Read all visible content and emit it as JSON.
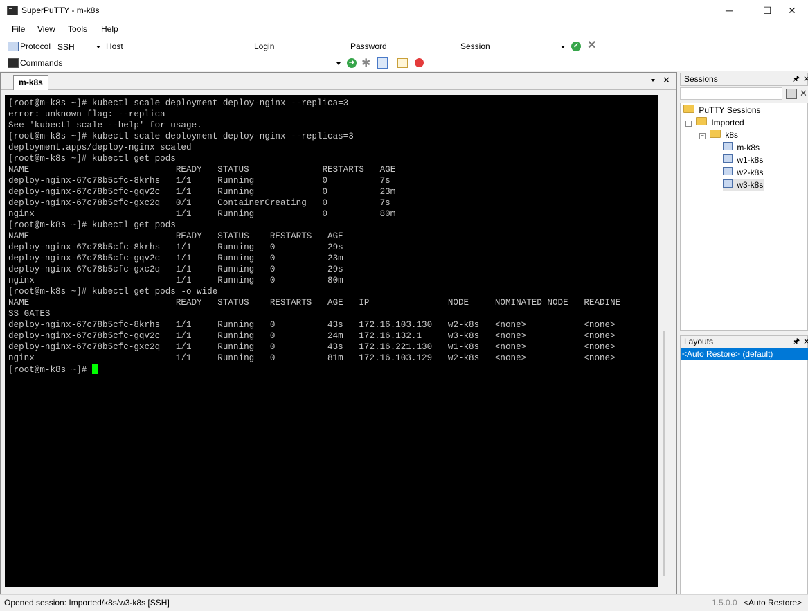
{
  "window": {
    "title": "SuperPuTTY - m-k8s",
    "controls": {
      "minimize": "─",
      "maximize": "☐",
      "close": "✕"
    }
  },
  "menu": [
    "File",
    "View",
    "Tools",
    "Help"
  ],
  "connection_bar": {
    "protocol_label": "Protocol",
    "protocol_value": "SSH",
    "host_label": "Host",
    "host_value": "",
    "login_label": "Login",
    "login_value": "",
    "password_label": "Password",
    "password_value": "",
    "session_label": "Session",
    "session_value": "",
    "connect_icon": "green-check-icon",
    "clear_icon": "x-icon"
  },
  "commands_bar": {
    "label": "Commands",
    "value": "",
    "icons": [
      "send-icon",
      "snowflake-icon",
      "script-icon",
      "edit-icon",
      "stop-record-icon"
    ]
  },
  "document": {
    "tab_label": "m-k8s",
    "terminal_lines": [
      "[root@m-k8s ~]# kubectl scale deployment deploy-nginx --replica=3",
      "error: unknown flag: --replica",
      "See 'kubectl scale --help' for usage.",
      "[root@m-k8s ~]# kubectl scale deployment deploy-nginx --replicas=3",
      "deployment.apps/deploy-nginx scaled",
      "[root@m-k8s ~]# kubectl get pods",
      "NAME                            READY   STATUS              RESTARTS   AGE",
      "deploy-nginx-67c78b5cfc-8krhs   1/1     Running             0          7s",
      "deploy-nginx-67c78b5cfc-gqv2c   1/1     Running             0          23m",
      "deploy-nginx-67c78b5cfc-gxc2q   0/1     ContainerCreating   0          7s",
      "nginx                           1/1     Running             0          80m",
      "[root@m-k8s ~]# kubectl get pods",
      "NAME                            READY   STATUS    RESTARTS   AGE",
      "deploy-nginx-67c78b5cfc-8krhs   1/1     Running   0          29s",
      "deploy-nginx-67c78b5cfc-gqv2c   1/1     Running   0          23m",
      "deploy-nginx-67c78b5cfc-gxc2q   1/1     Running   0          29s",
      "nginx                           1/1     Running   0          80m",
      "[root@m-k8s ~]# kubectl get pods -o wide",
      "NAME                            READY   STATUS    RESTARTS   AGE   IP               NODE     NOMINATED NODE   READINE",
      "SS GATES",
      "deploy-nginx-67c78b5cfc-8krhs   1/1     Running   0          43s   172.16.103.130   w2-k8s   <none>           <none>",
      "deploy-nginx-67c78b5cfc-gqv2c   1/1     Running   0          24m   172.16.132.1     w3-k8s   <none>           <none>",
      "deploy-nginx-67c78b5cfc-gxc2q   1/1     Running   0          43s   172.16.221.130   w1-k8s   <none>           <none>",
      "nginx                           1/1     Running   0          81m   172.16.103.129   w2-k8s   <none>           <none>",
      "[root@m-k8s ~]# "
    ],
    "cursor_color": "#00ff00"
  },
  "sessions_panel": {
    "title": "Sessions",
    "search_value": "",
    "tree": {
      "root": "PuTTY Sessions",
      "folder": "Imported",
      "subfolder": "k8s",
      "sessions": [
        "m-k8s",
        "w1-k8s",
        "w2-k8s",
        "w3-k8s"
      ],
      "selected": "w3-k8s"
    }
  },
  "layouts_panel": {
    "title": "Layouts",
    "items": [
      "<Auto Restore> (default)"
    ],
    "selected": "<Auto Restore> (default)"
  },
  "status_bar": {
    "message": "Opened session: Imported/k8s/w3-k8s [SSH]",
    "version": "1.5.0.0",
    "layout": "<Auto Restore>"
  },
  "colors": {
    "terminal_bg": "#000000",
    "terminal_fg": "#c7c7c7",
    "selection": "#0078d7"
  }
}
